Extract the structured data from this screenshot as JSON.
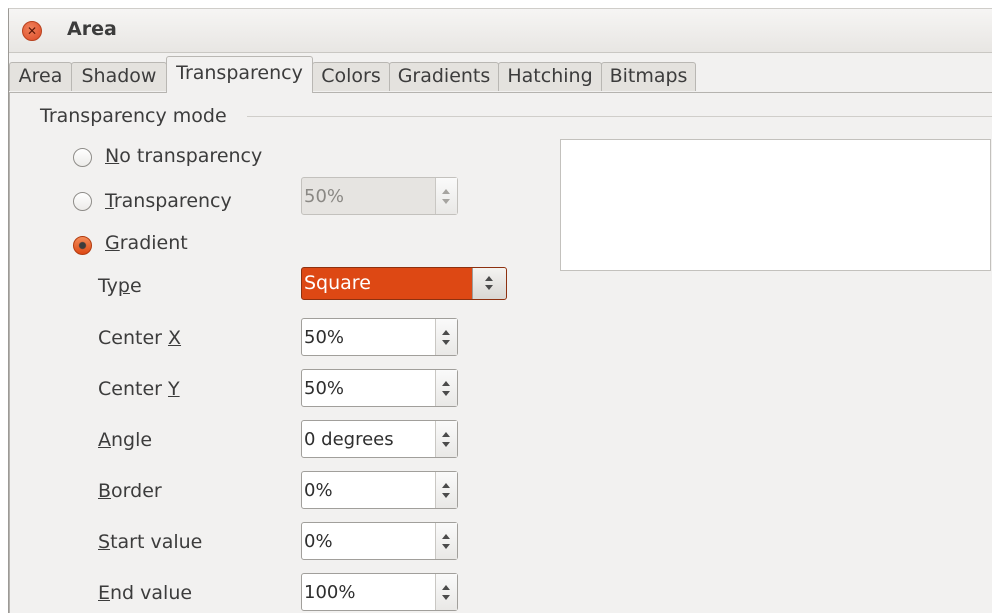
{
  "window": {
    "title": "Area"
  },
  "tabs": [
    {
      "label": "Area"
    },
    {
      "label": "Shadow"
    },
    {
      "label": "Transparency",
      "active": true
    },
    {
      "label": "Colors"
    },
    {
      "label": "Gradients"
    },
    {
      "label": "Hatching"
    },
    {
      "label": "Bitmaps"
    }
  ],
  "section": {
    "label": "Transparency mode"
  },
  "radios": {
    "no_transparency": {
      "mnemonic": "N",
      "rest": "o transparency",
      "checked": false
    },
    "transparency": {
      "mnemonic": "T",
      "rest": "ransparency",
      "checked": false,
      "value": "50%",
      "disabled": true
    },
    "gradient": {
      "mnemonic": "G",
      "rest": "radient",
      "checked": true
    }
  },
  "fields": {
    "type": {
      "pre": "Ty",
      "mnemonic": "p",
      "post": "e",
      "value": "Square"
    },
    "center_x": {
      "pre": "Center ",
      "mnemonic": "X",
      "post": "",
      "value": "50%"
    },
    "center_y": {
      "pre": "Center ",
      "mnemonic": "Y",
      "post": "",
      "value": "50%"
    },
    "angle": {
      "pre": "",
      "mnemonic": "A",
      "post": "ngle",
      "value": "0 degrees"
    },
    "border": {
      "pre": "",
      "mnemonic": "B",
      "post": "order",
      "value": "0%"
    },
    "start_value": {
      "pre": "",
      "mnemonic": "S",
      "post": "tart value",
      "value": "0%"
    },
    "end_value": {
      "pre": "",
      "mnemonic": "E",
      "post": "nd value",
      "value": "100%"
    }
  },
  "colors": {
    "accent": "#dd4814",
    "background": "#f2f1f0"
  }
}
